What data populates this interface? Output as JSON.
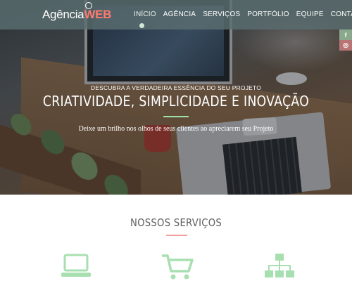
{
  "brand": {
    "prefix": "Agência",
    "suffix": "WEB"
  },
  "nav": {
    "items": [
      {
        "label": "INÍCIO",
        "active": true
      },
      {
        "label": "AGÊNCIA",
        "active": false
      },
      {
        "label": "SERVIÇOS",
        "active": false
      },
      {
        "label": "PORTFÓLIO",
        "active": false
      },
      {
        "label": "EQUIPE",
        "active": false
      },
      {
        "label": "CONTATO",
        "active": false
      }
    ]
  },
  "social": {
    "facebook": "f",
    "instagram": "◎"
  },
  "hero": {
    "kicker": "DESCUBRA A VERDADEIRA ESSÊNCIA DO SEU PROJETO",
    "headline": "CRIATIVIDADE, SIMPLICIDADE E INOVAÇÃO",
    "subtitle": "Deixe um brilho nos olhos de seus clientes ao apreciarem seu Projeto"
  },
  "services": {
    "title": "NOSSOS SERVIÇOS",
    "icons": [
      "laptop-icon",
      "shopping-cart-icon",
      "sitemap-icon"
    ]
  },
  "colors": {
    "accent_green": "#9fe0a5",
    "accent_red": "#f2a09b",
    "nav_bg": "#5a6e70",
    "icon_green": "#a8dfb0"
  }
}
